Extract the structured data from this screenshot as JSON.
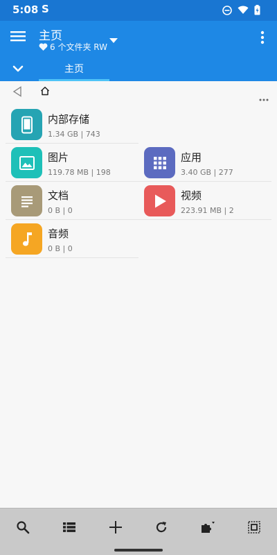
{
  "status": {
    "time": "5:08",
    "s_icon": "S"
  },
  "appbar": {
    "title": "主页",
    "subtitle": "6 个文件夹 RW"
  },
  "tabs": [
    {
      "label": "主页"
    }
  ],
  "tiles": [
    {
      "name": "内部存储",
      "meta": "1.34 GB | 743",
      "icon": "phone-icon",
      "color": "#26a4b3"
    },
    {
      "name": "图片",
      "meta": "119.78 MB | 198",
      "icon": "image-icon",
      "color": "#1ec0b8"
    },
    {
      "name": "应用",
      "meta": "3.40 GB | 277",
      "icon": "apps-grid-icon",
      "color": "#5c6bc0"
    },
    {
      "name": "文档",
      "meta": "0 B | 0",
      "icon": "document-icon",
      "color": "#a89a78"
    },
    {
      "name": "视频",
      "meta": "223.91 MB | 2",
      "icon": "play-icon",
      "color": "#e85a5a"
    },
    {
      "name": "音频",
      "meta": "0 B | 0",
      "icon": "music-note-icon",
      "color": "#f5a623"
    }
  ],
  "colors": {
    "status_bar": "#1976d2",
    "app_bar": "#1e88e5",
    "tab_indicator": "#4fc3f7",
    "bottom_bar": "#c9c9c9"
  }
}
